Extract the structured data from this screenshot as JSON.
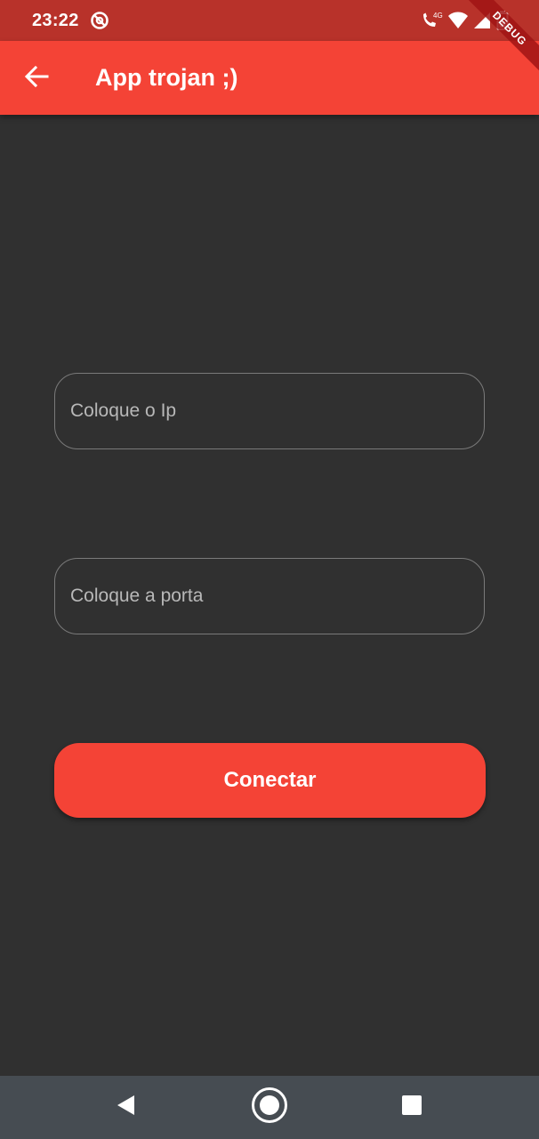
{
  "status_bar": {
    "time": "23:22",
    "icons": [
      "dnd-icon",
      "volte-call-icon",
      "wifi-icon",
      "signal-icon",
      "battery-icon"
    ],
    "network_label": "4G"
  },
  "debug_banner": "DEBUG",
  "app_bar": {
    "title": "App trojan ;)",
    "back_icon": "arrow-back-icon"
  },
  "form": {
    "ip_placeholder": "Coloque o Ip",
    "port_placeholder": "Coloque a porta",
    "connect_label": "Conectar"
  },
  "nav_bar": {
    "items": [
      "back-triangle-icon",
      "home-circle-icon",
      "recents-square-icon"
    ]
  },
  "colors": {
    "primary": "#f44336",
    "status_bar": "#b8322a",
    "background": "#303030",
    "nav_bar": "#464c52"
  }
}
